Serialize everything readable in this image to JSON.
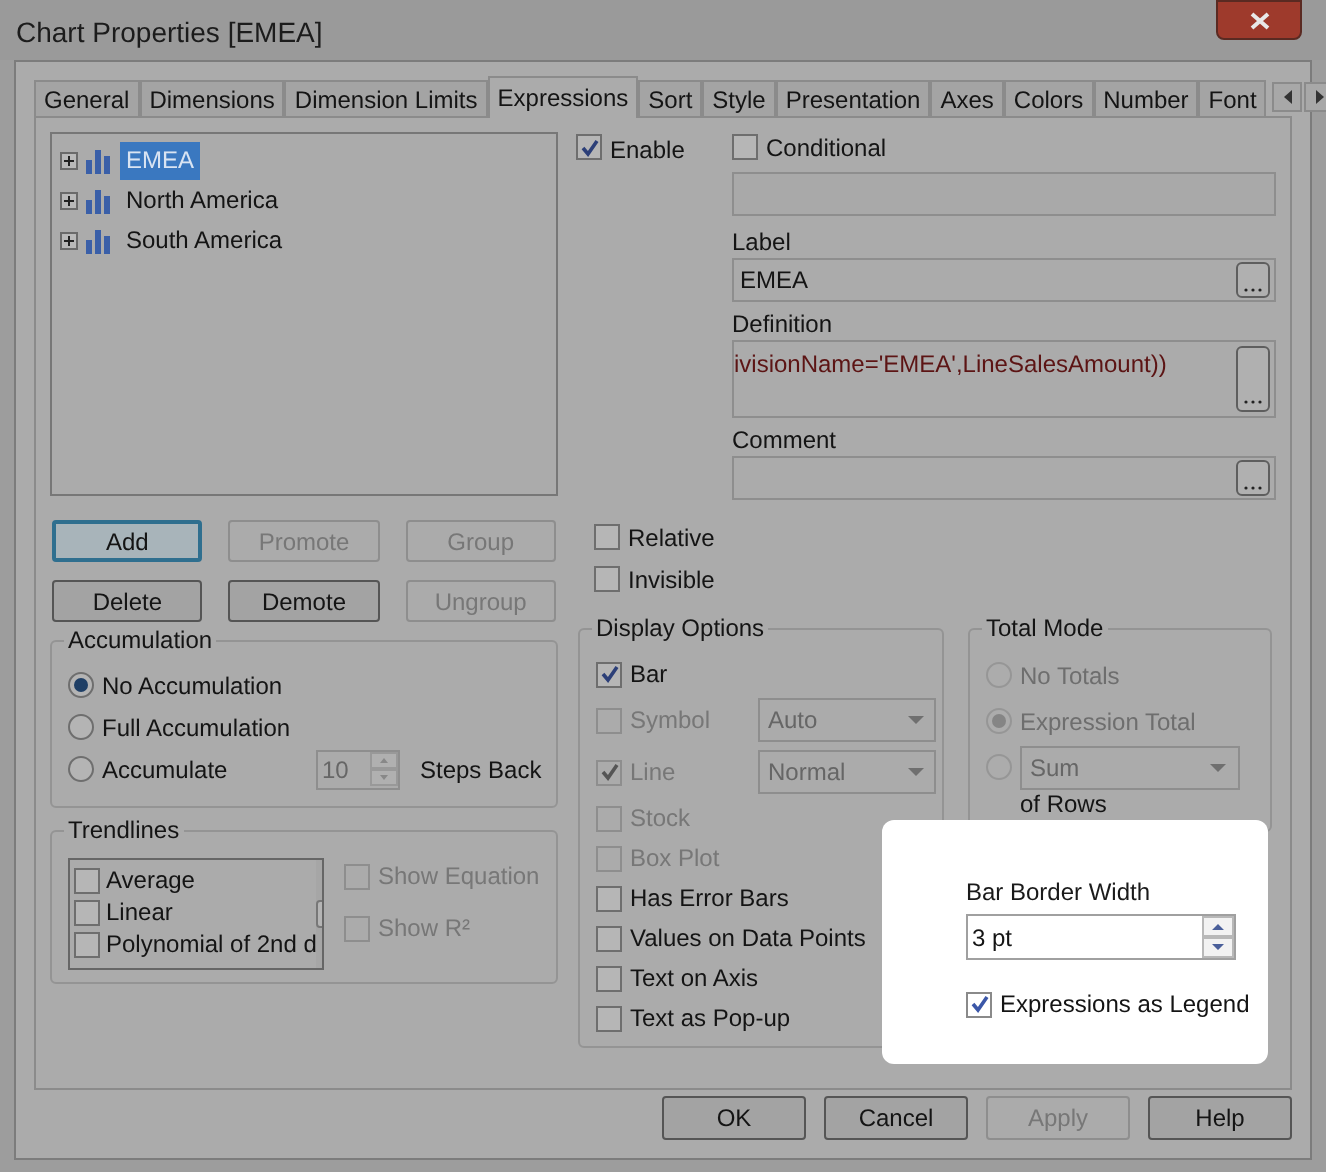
{
  "window": {
    "title": "Chart Properties [EMEA]"
  },
  "tabs": [
    {
      "label": "General",
      "selected": false
    },
    {
      "label": "Dimensions",
      "selected": false
    },
    {
      "label": "Dimension Limits",
      "selected": false
    },
    {
      "label": "Expressions",
      "selected": true
    },
    {
      "label": "Sort",
      "selected": false
    },
    {
      "label": "Style",
      "selected": false
    },
    {
      "label": "Presentation",
      "selected": false
    },
    {
      "label": "Axes",
      "selected": false
    },
    {
      "label": "Colors",
      "selected": false
    },
    {
      "label": "Number",
      "selected": false
    },
    {
      "label": "Font",
      "selected": false
    }
  ],
  "expressions": [
    {
      "label": "EMEA",
      "selected": true
    },
    {
      "label": "North America",
      "selected": false
    },
    {
      "label": "South America",
      "selected": false
    }
  ],
  "expression_buttons": [
    {
      "label": "Add",
      "disabled": false,
      "default": true
    },
    {
      "label": "Promote",
      "disabled": true,
      "default": false
    },
    {
      "label": "Group",
      "disabled": true,
      "default": false
    },
    {
      "label": "Delete",
      "disabled": false,
      "default": false
    },
    {
      "label": "Demote",
      "disabled": false,
      "default": false
    },
    {
      "label": "Ungroup",
      "disabled": true,
      "default": false
    }
  ],
  "accumulation": {
    "title": "Accumulation",
    "options": [
      {
        "label": "No Accumulation",
        "selected": true
      },
      {
        "label": "Full Accumulation",
        "selected": false
      },
      {
        "label": "Accumulate",
        "selected": false
      }
    ],
    "steps": "10",
    "steps_label": "Steps Back"
  },
  "trendlines": {
    "title": "Trendlines",
    "items": [
      {
        "label": "Average",
        "checked": false
      },
      {
        "label": "Linear",
        "checked": false
      },
      {
        "label": "Polynomial of 2nd d",
        "checked": false
      }
    ],
    "options": [
      {
        "label": "Show Equation",
        "checked": false,
        "disabled": true
      },
      {
        "label": "Show R²",
        "checked": false,
        "disabled": true
      }
    ]
  },
  "enable": {
    "label": "Enable",
    "checked": true
  },
  "conditional": {
    "label": "Conditional",
    "checked": false
  },
  "label_field": {
    "label": "Label",
    "value": "EMEA"
  },
  "definition": {
    "label": "Definition",
    "value": "ivisionName='EMEA',LineSalesAmount))"
  },
  "comment": {
    "label": "Comment"
  },
  "flags": [
    {
      "label": "Relative",
      "checked": false
    },
    {
      "label": "Invisible",
      "checked": false
    }
  ],
  "display_options": {
    "title": "Display Options",
    "items": [
      {
        "kind": "check",
        "label": "Bar",
        "checked": true,
        "disabled": false
      },
      {
        "kind": "select",
        "label": "Symbol",
        "checked": false,
        "disabled": true,
        "value": "Auto"
      },
      {
        "kind": "select",
        "label": "Line",
        "checked": true,
        "disabled": true,
        "value": "Normal"
      },
      {
        "kind": "check",
        "label": "Stock",
        "checked": false,
        "disabled": true
      },
      {
        "kind": "check",
        "label": "Box Plot",
        "checked": false,
        "disabled": true
      },
      {
        "kind": "check",
        "label": "Has Error Bars",
        "checked": false,
        "disabled": false
      },
      {
        "kind": "check",
        "label": "Values on Data Points",
        "checked": false,
        "disabled": false
      },
      {
        "kind": "check",
        "label": "Text on Axis",
        "checked": false,
        "disabled": false
      },
      {
        "kind": "check",
        "label": "Text as Pop-up",
        "checked": false,
        "disabled": false
      }
    ]
  },
  "total_mode": {
    "title": "Total Mode",
    "options": [
      {
        "kind": "radio",
        "label": "No Totals",
        "selected": false
      },
      {
        "kind": "radio",
        "label": "Expression Total",
        "selected": true
      },
      {
        "kind": "select",
        "value": "Sum",
        "selected": false
      }
    ],
    "suffix": "of Rows"
  },
  "bar_border_width": {
    "label": "Bar Border Width",
    "value": "3 pt"
  },
  "legend": {
    "label": "Expressions as Legend",
    "checked": true
  },
  "buttons": [
    {
      "label": "OK",
      "disabled": false
    },
    {
      "label": "Cancel",
      "disabled": false
    },
    {
      "label": "Apply",
      "disabled": true
    },
    {
      "label": "Help",
      "disabled": false
    }
  ]
}
